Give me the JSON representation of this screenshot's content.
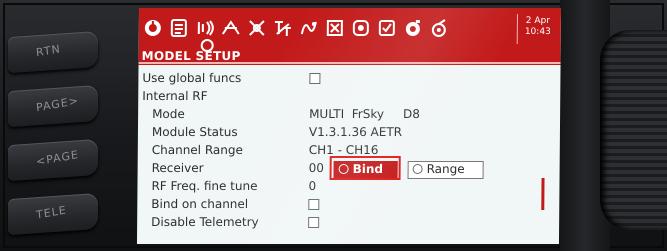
{
  "hardware": {
    "keys": [
      {
        "label": "RTN"
      },
      {
        "label": "PAGE>"
      },
      {
        "label": "<PAGE"
      },
      {
        "label": "TELE"
      }
    ]
  },
  "topbar": {
    "icons": [
      "radio-home-icon",
      "model-list-icon",
      "hardware-icon",
      "mixes-icon",
      "inputs-icon",
      "curves-icon",
      "logical-switches-icon",
      "special-functions-icon",
      "telemetry-icon",
      "checklist-icon",
      "timer-icon",
      "sound-icon"
    ],
    "date": "2 Apr",
    "time": "10:43"
  },
  "title": "MODEL SETUP",
  "rows": {
    "use_global_funcs": {
      "label": "Use global funcs"
    },
    "internal_rf": {
      "label": "Internal RF"
    },
    "mode": {
      "label": "Mode",
      "value": "MULTI  FrSky     D8"
    },
    "module_status": {
      "label": "Module Status",
      "value": "V1.3.1.36 AETR"
    },
    "channel_range": {
      "label": "Channel Range",
      "value": "CH1 - CH16"
    },
    "receiver": {
      "label": "Receiver",
      "value": "00",
      "bind_label": "Bind",
      "range_label": "Range"
    },
    "rf_freq": {
      "label": "RF Freq. fine tune",
      "value": "0"
    },
    "bind_on_channel": {
      "label": "Bind on channel"
    },
    "disable_telemetry": {
      "label": "Disable Telemetry"
    }
  },
  "colors": {
    "accent": "#c21a1a",
    "highlight_box": "#e21818",
    "screen_bg": "#f1f6f6"
  }
}
